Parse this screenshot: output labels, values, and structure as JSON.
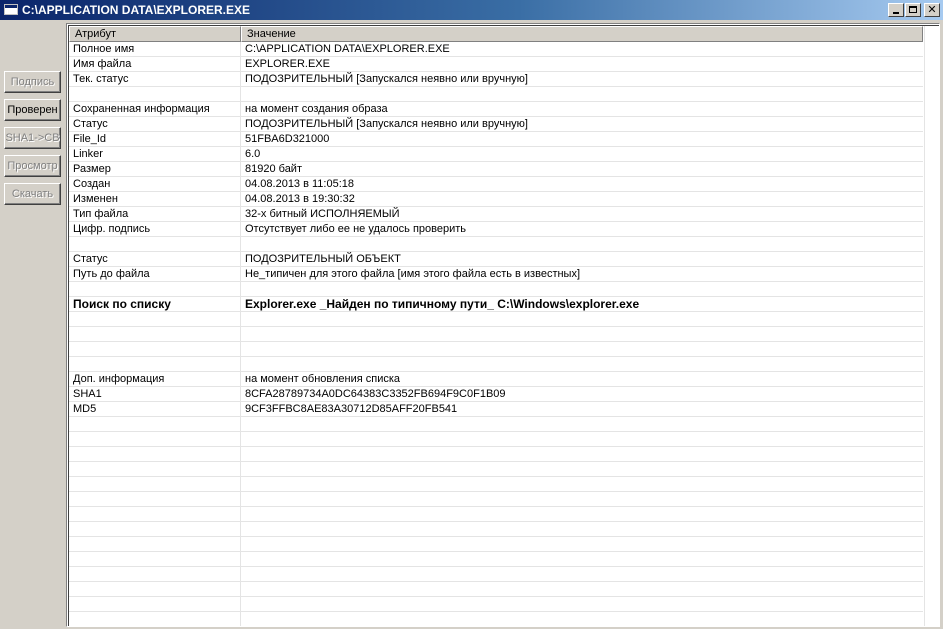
{
  "window": {
    "title": "C:\\APPLICATION DATA\\EXPLORER.EXE",
    "controls": {
      "minimize": "_",
      "maximize": "□",
      "close": "✕"
    }
  },
  "sidebar": {
    "buttons": [
      {
        "label": "Подпись",
        "enabled": false
      },
      {
        "label": "Проверен",
        "enabled": true
      },
      {
        "label": "SHA1->CB",
        "enabled": false
      },
      {
        "label": "Просмотр",
        "enabled": false
      },
      {
        "label": "Скачать",
        "enabled": false
      }
    ]
  },
  "grid": {
    "columns": [
      "Атрибут",
      "Значение"
    ],
    "rows": [
      {
        "attr": "Полное имя",
        "value": "C:\\APPLICATION DATA\\EXPLORER.EXE"
      },
      {
        "attr": "Имя файла",
        "value": "EXPLORER.EXE"
      },
      {
        "attr": "Тек. статус",
        "value": "ПОДОЗРИТЕЛЬНЫЙ [Запускался неявно или вручную]"
      },
      {
        "attr": "",
        "value": ""
      },
      {
        "attr": "Сохраненная информация",
        "value": "на момент создания образа"
      },
      {
        "attr": "Статус",
        "value": "ПОДОЗРИТЕЛЬНЫЙ [Запускался неявно или вручную]"
      },
      {
        "attr": "File_Id",
        "value": "51FBA6D321000"
      },
      {
        "attr": "Linker",
        "value": "6.0"
      },
      {
        "attr": "Размер",
        "value": "81920 байт"
      },
      {
        "attr": "Создан",
        "value": "04.08.2013 в 11:05:18"
      },
      {
        "attr": "Изменен",
        "value": "04.08.2013 в 19:30:32"
      },
      {
        "attr": "Тип файла",
        "value": "32-х битный ИСПОЛНЯЕМЫЙ"
      },
      {
        "attr": "Цифр. подпись",
        "value": "Отсутствует либо ее не удалось проверить"
      },
      {
        "attr": "",
        "value": ""
      },
      {
        "attr": "Статус",
        "value": "ПОДОЗРИТЕЛЬНЫЙ ОБЪЕКТ"
      },
      {
        "attr": "Путь до файла",
        "value": "Не_типичен для этого файла [имя этого файла есть в известных]"
      },
      {
        "attr": "",
        "value": ""
      },
      {
        "attr": "Поиск по списку",
        "value": "Explorer.exe  _Найден по типичному пути_ C:\\Windows\\explorer.exe",
        "bold": true
      },
      {
        "attr": "",
        "value": ""
      },
      {
        "attr": "",
        "value": ""
      },
      {
        "attr": "",
        "value": ""
      },
      {
        "attr": "",
        "value": ""
      },
      {
        "attr": "Доп. информация",
        "value": "на момент обновления списка"
      },
      {
        "attr": "SHA1",
        "value": "8CFA28789734A0DC64383C3352FB694F9C0F1B09"
      },
      {
        "attr": "MD5",
        "value": "9CF3FFBC8AE83A30712D85AFF20FB541"
      }
    ]
  }
}
